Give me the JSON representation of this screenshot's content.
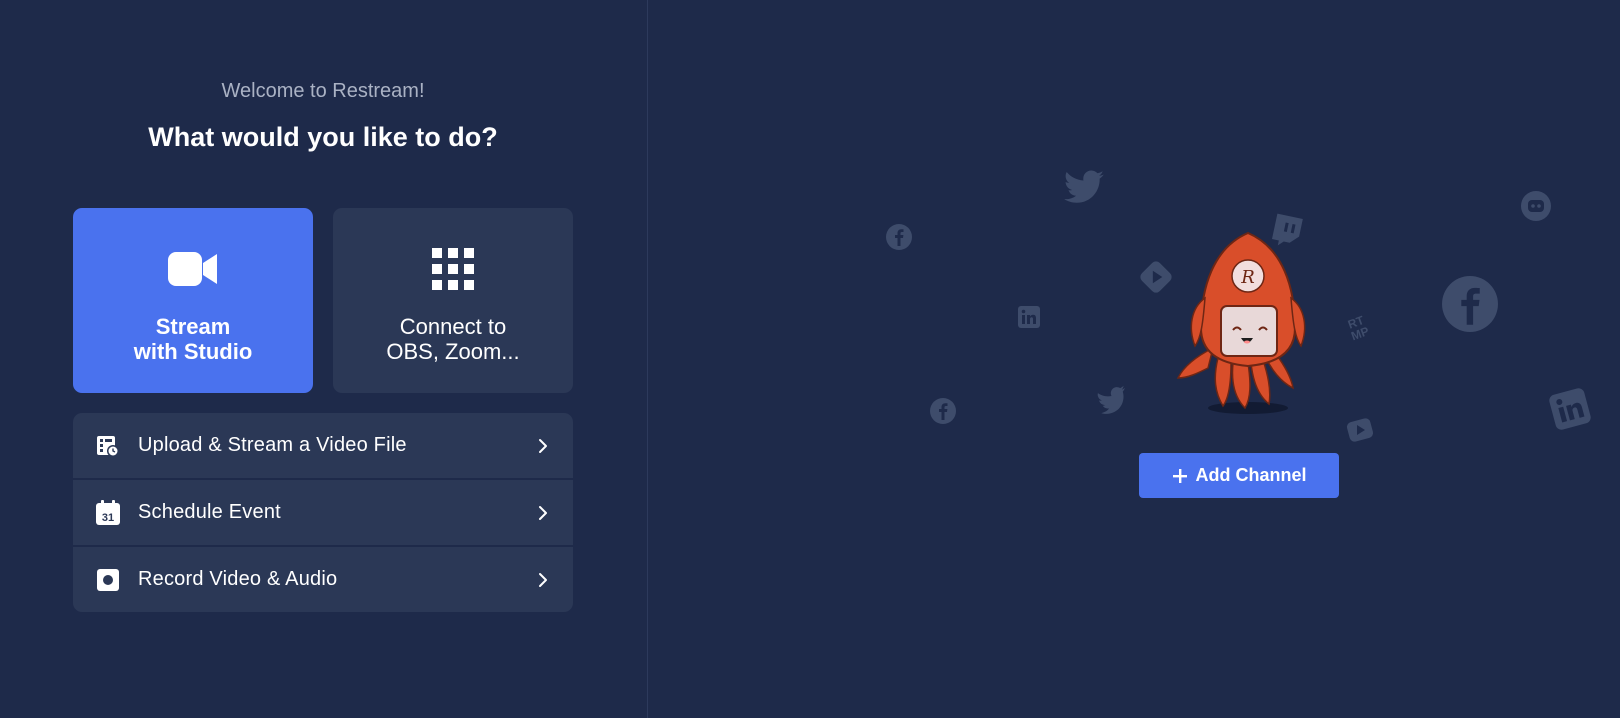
{
  "welcome": {
    "subtitle": "Welcome to Restream!",
    "headline": "What would you like to do?"
  },
  "cards": {
    "studio": {
      "line1": "Stream",
      "line2": "with Studio",
      "icon": "video-camera-icon"
    },
    "connect": {
      "line1": "Connect to",
      "line2": "OBS, Zoom...",
      "icon": "grid-icon"
    }
  },
  "actions": [
    {
      "label": "Upload & Stream a Video File",
      "icon": "video-file-upload-icon"
    },
    {
      "label": "Schedule Event",
      "icon": "calendar-icon",
      "calendar_day": "31"
    },
    {
      "label": "Record Video & Audio",
      "icon": "record-icon"
    }
  ],
  "right": {
    "add_channel_label": "Add Channel",
    "mascot_letter": "R",
    "rtmp_text": "RTMP"
  },
  "colors": {
    "background": "#1e2a4a",
    "card": "#2b3856",
    "accent": "#4a72ee",
    "mascot": "#d94e2a",
    "social_icon": "#3e4c6b"
  }
}
